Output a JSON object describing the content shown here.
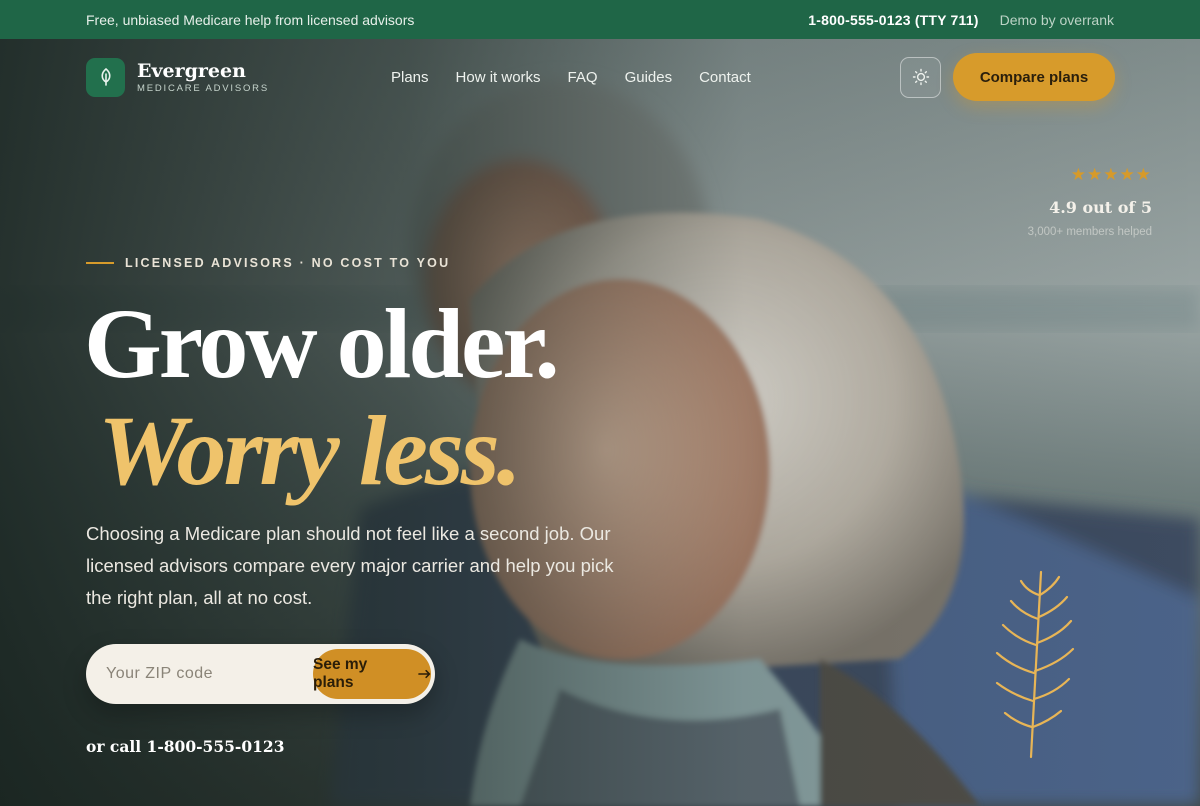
{
  "topbar": {
    "tagline": "Free, unbiased Medicare help from licensed advisors",
    "phone": "1-800-555-0123 (TTY 711)",
    "demo": "Demo by overrank"
  },
  "brand": {
    "name": "Evergreen",
    "sub": "MEDICARE ADVISORS",
    "icon": "leaf-icon"
  },
  "nav": {
    "links": [
      "Plans",
      "How it works",
      "FAQ",
      "Guides",
      "Contact"
    ],
    "theme_icon": "sun-icon",
    "cta": "Compare plans"
  },
  "rating": {
    "stars": "★★★★★",
    "score": "4.9 out of 5",
    "helped": "3,000+ members helped"
  },
  "hero": {
    "eyebrow": "LICENSED ADVISORS · NO COST TO YOU",
    "headline_1": "Grow older.",
    "headline_2": "Worry less.",
    "lede": "Choosing a Medicare plan should not feel like a second job. Our licensed advisors compare every major carrier and help you pick the right plan, all at no cost.",
    "zip_placeholder": "Your ZIP code",
    "zip_button": "See my plans",
    "zip_button_icon": "arrow-right-icon",
    "call": "or call 1-800-555-0123"
  },
  "colors": {
    "topbar": "#1f6647",
    "accent": "#d79b2b",
    "headline_accent": "#efc36b",
    "brand_green": "#22704d"
  }
}
